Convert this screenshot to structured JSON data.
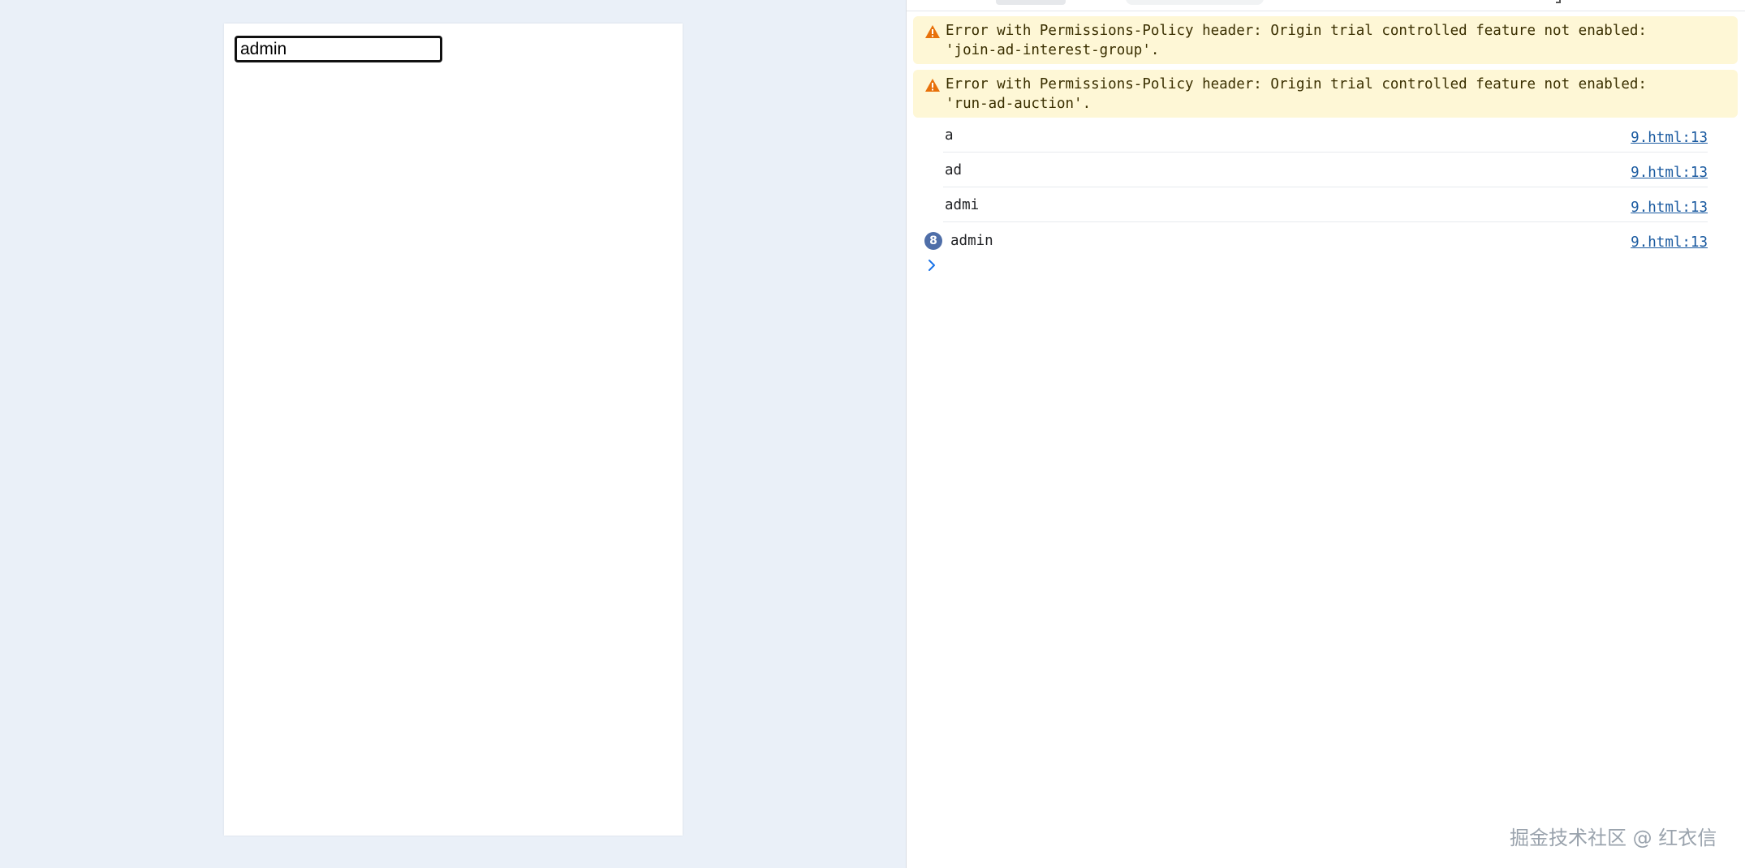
{
  "page": {
    "input": {
      "value": "admin"
    }
  },
  "devtools": {
    "warnings": [
      {
        "line1": "Error with Permissions-Policy header: Origin trial controlled feature not enabled:",
        "line2": "'join-ad-interest-group'.",
        "icon": "warning-triangle-icon"
      },
      {
        "line1": "Error with Permissions-Policy header: Origin trial controlled feature not enabled:",
        "line2": "'run-ad-auction'.",
        "icon": "warning-triangle-icon"
      }
    ],
    "logs": [
      {
        "message": "a",
        "source": "9.html:13"
      },
      {
        "message": "ad",
        "source": "9.html:13"
      },
      {
        "message": "admi",
        "source": "9.html:13"
      },
      {
        "message": "admin",
        "source": "9.html:13",
        "repeat_count": "8"
      }
    ],
    "prompt_icon": "chevron-right-icon"
  },
  "watermark": "掘金技术社区 @ 红衣信",
  "colors": {
    "background": "#eaf0f8",
    "warning_bg": "#fef7d6",
    "warning_icon": "#e8710a",
    "link": "#1a5aa0",
    "badge": "#4f6ea8",
    "prompt": "#1a73e8"
  }
}
